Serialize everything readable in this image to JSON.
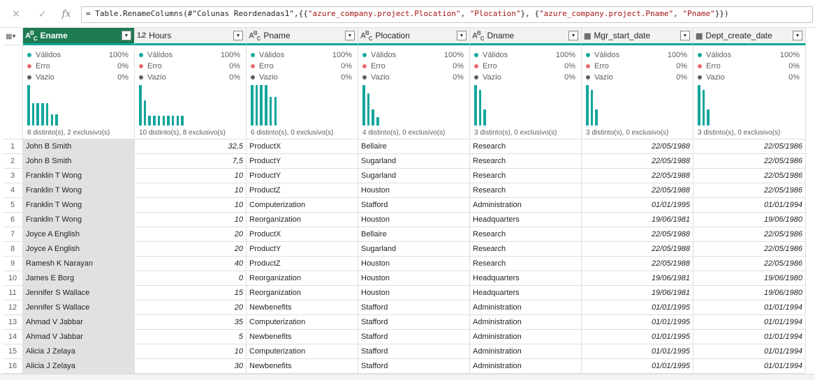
{
  "formula": {
    "cancel_icon": "x-icon",
    "confirm_icon": "check-icon",
    "fx_label": "fx",
    "prefix": "= Table.RenameColumns(#\"Colunas Reordenadas1\",{{",
    "s1": "\"azure_company.project.Plocation\"",
    "sep1": ", ",
    "s2": "\"Plocation\"",
    "sep2": "}, {",
    "s3": "\"azure_company.project.Pname\"",
    "sep3": ", ",
    "s4": "\"Pname\"",
    "suffix": "}})"
  },
  "colors": {
    "accent": "#12a69b",
    "selected_header": "#1d7a52",
    "error": "#e66c6c",
    "empty": "#605e5c"
  },
  "columns": [
    {
      "type": "ABC",
      "name": "Ename",
      "valid_label": "Válidos",
      "valid": "100%",
      "error_label": "Erro",
      "error": "0%",
      "empty_label": "Vazio",
      "empty": "0%",
      "distinct": "8 distinto(s), 2 exclusivo(s)",
      "hist": [
        1.0,
        0.55,
        0.55,
        0.55,
        0.55,
        0.28,
        0.28
      ]
    },
    {
      "type": "1.2",
      "name": "Hours",
      "valid_label": "Válidos",
      "valid": "100%",
      "error_label": "Erro",
      "error": "0%",
      "empty_label": "Vazio",
      "empty": "0%",
      "distinct": "10 distinto(s), 8 exclusivo(s)",
      "hist": [
        1.0,
        0.62,
        0.24,
        0.24,
        0.24,
        0.24,
        0.24,
        0.24,
        0.24,
        0.24
      ]
    },
    {
      "type": "ABC",
      "name": "Pname",
      "valid_label": "Válidos",
      "valid": "100%",
      "error_label": "Erro",
      "error": "0%",
      "empty_label": "Vazio",
      "empty": "0%",
      "distinct": "6 distinto(s), 0 exclusivo(s)",
      "hist": [
        1.0,
        1.0,
        1.0,
        1.0,
        0.7,
        0.7
      ]
    },
    {
      "type": "ABC",
      "name": "Plocation",
      "valid_label": "Válidos",
      "valid": "100%",
      "error_label": "Erro",
      "error": "0%",
      "empty_label": "Vazio",
      "empty": "0%",
      "distinct": "4 distinto(s), 0 exclusivo(s)",
      "hist": [
        1.0,
        0.8,
        0.4,
        0.2
      ]
    },
    {
      "type": "ABC",
      "name": "Dname",
      "valid_label": "Válidos",
      "valid": "100%",
      "error_label": "Erro",
      "error": "0%",
      "empty_label": "Vazio",
      "empty": "0%",
      "distinct": "3 distinto(s), 0 exclusivo(s)",
      "hist": [
        1.0,
        0.88,
        0.4
      ]
    },
    {
      "type": "CAL",
      "name": "Mgr_start_date",
      "valid_label": "Válidos",
      "valid": "100%",
      "error_label": "Erro",
      "error": "0%",
      "empty_label": "Vazio",
      "empty": "0%",
      "distinct": "3 distinto(s), 0 exclusivo(s)",
      "hist": [
        1.0,
        0.88,
        0.4
      ]
    },
    {
      "type": "CAL",
      "name": "Dept_create_date",
      "valid_label": "Válidos",
      "valid": "100%",
      "error_label": "Erro",
      "error": "0%",
      "empty_label": "Vazio",
      "empty": "0%",
      "distinct": "3 distinto(s), 0 exclusivo(s)",
      "hist": [
        1.0,
        0.88,
        0.4
      ]
    }
  ],
  "rows": [
    [
      "1",
      "John B Smith",
      "32,5",
      "ProductX",
      "Bellaire",
      "Research",
      "22/05/1988",
      "22/05/1986"
    ],
    [
      "2",
      "John B Smith",
      "7,5",
      "ProductY",
      "Sugarland",
      "Research",
      "22/05/1988",
      "22/05/1986"
    ],
    [
      "3",
      "Franklin T Wong",
      "10",
      "ProductY",
      "Sugarland",
      "Research",
      "22/05/1988",
      "22/05/1986"
    ],
    [
      "4",
      "Franklin T Wong",
      "10",
      "ProductZ",
      "Houston",
      "Research",
      "22/05/1988",
      "22/05/1986"
    ],
    [
      "5",
      "Franklin T Wong",
      "10",
      "Computerization",
      "Stafford",
      "Administration",
      "01/01/1995",
      "01/01/1994"
    ],
    [
      "6",
      "Franklin T Wong",
      "10",
      "Reorganization",
      "Houston",
      "Headquarters",
      "19/06/1981",
      "19/06/1980"
    ],
    [
      "7",
      "Joyce A English",
      "20",
      "ProductX",
      "Bellaire",
      "Research",
      "22/05/1988",
      "22/05/1986"
    ],
    [
      "8",
      "Joyce A English",
      "20",
      "ProductY",
      "Sugarland",
      "Research",
      "22/05/1988",
      "22/05/1986"
    ],
    [
      "9",
      "Ramesh K Narayan",
      "40",
      "ProductZ",
      "Houston",
      "Research",
      "22/05/1988",
      "22/05/1986"
    ],
    [
      "10",
      "James E Borg",
      "0",
      "Reorganization",
      "Houston",
      "Headquarters",
      "19/06/1981",
      "19/06/1980"
    ],
    [
      "11",
      "Jennifer S Wallace",
      "15",
      "Reorganization",
      "Houston",
      "Headquarters",
      "19/06/1981",
      "19/06/1980"
    ],
    [
      "12",
      "Jennifer S Wallace",
      "20",
      "Newbenefits",
      "Stafford",
      "Administration",
      "01/01/1995",
      "01/01/1994"
    ],
    [
      "13",
      "Ahmad V Jabbar",
      "35",
      "Computerization",
      "Stafford",
      "Administration",
      "01/01/1995",
      "01/01/1994"
    ],
    [
      "14",
      "Ahmad V Jabbar",
      "5",
      "Newbenefits",
      "Stafford",
      "Administration",
      "01/01/1995",
      "01/01/1994"
    ],
    [
      "15",
      "Alicia J Zelaya",
      "10",
      "Computerization",
      "Stafford",
      "Administration",
      "01/01/1995",
      "01/01/1994"
    ],
    [
      "16",
      "Alicia J Zelaya",
      "30",
      "Newbenefits",
      "Stafford",
      "Administration",
      "01/01/1995",
      "01/01/1994"
    ]
  ]
}
